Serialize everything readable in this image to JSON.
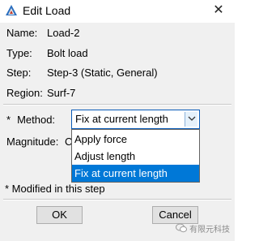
{
  "window": {
    "title": "Edit Load",
    "close_glyph": "✕"
  },
  "info": [
    {
      "label": "Name:",
      "value": "Load-2"
    },
    {
      "label": "Type:",
      "value": "Bolt load"
    },
    {
      "label": "Step:",
      "value": "Step-3 (Static, General)"
    },
    {
      "label": "Region:",
      "value": "Surf-7"
    }
  ],
  "method": {
    "required_marker": "*",
    "label": "Method:",
    "selected": "Fix at current length",
    "options": [
      "Apply force",
      "Adjust length",
      "Fix at current length"
    ]
  },
  "magnitude": {
    "label": "Magnitude:",
    "partial_text": "C"
  },
  "note": "* Modified in this step",
  "buttons": {
    "ok": "OK",
    "cancel": "Cancel"
  },
  "watermark": "有限元科技",
  "colors": {
    "highlight": "#0078d7",
    "focus_border": "#0a5cb8"
  }
}
